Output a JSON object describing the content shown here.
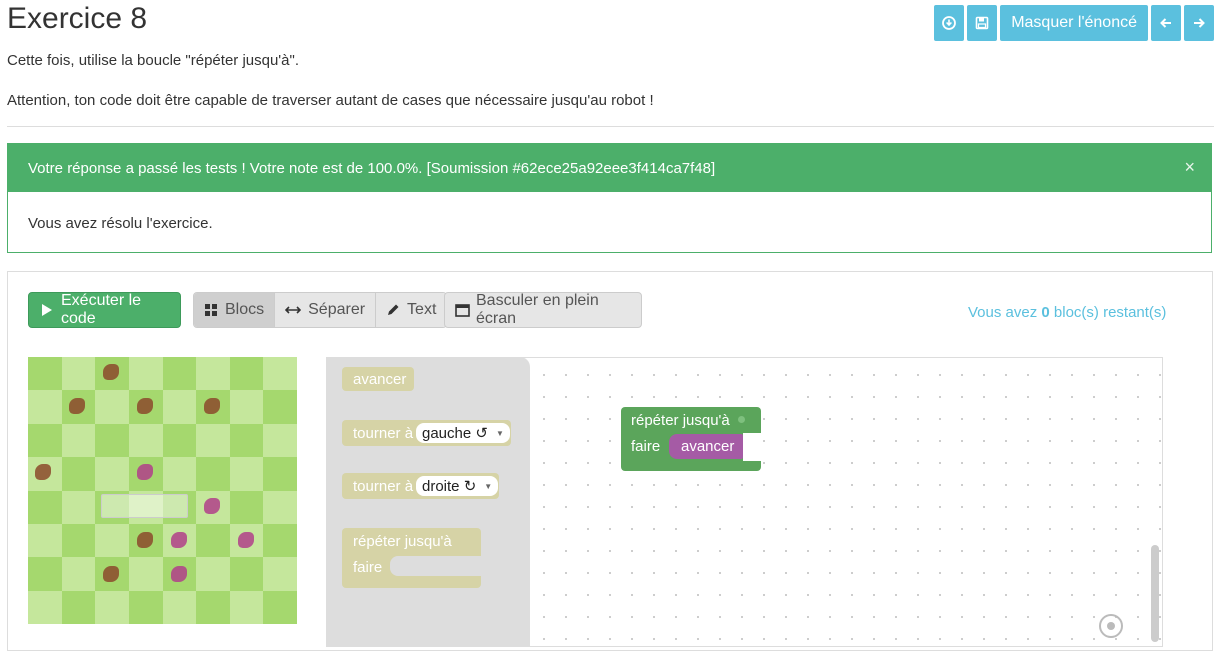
{
  "header": {
    "title": "Exercice 8",
    "buttons": {
      "download_icon": "download-icon",
      "save_icon": "save-icon",
      "hide_statement_label": "Masquer l'énoncé",
      "prev_icon": "arrow-left-icon",
      "next_icon": "arrow-right-icon"
    }
  },
  "statement": {
    "line1": "Cette fois, utilise la boucle \"répéter jusqu'à\".",
    "line2": "Attention, ton code doit être capable de traverser autant de cases que nécessaire jusqu'au robot !"
  },
  "alert": {
    "message": "Votre réponse a passé les tests ! Votre note est de 100.0%. [Soumission #62ece25a92eee3f414ca7f48]",
    "close": "×",
    "body": "Vous avez résolu l'exercice.",
    "color": "#4caf6a"
  },
  "toolbar": {
    "run_label": "Exécuter le code",
    "view_blocks": "Blocs",
    "view_split": "Séparer",
    "view_text": "Text",
    "fullscreen_label": "Basculer en plein écran",
    "remaining_prefix": "Vous avez ",
    "remaining_count": "0",
    "remaining_suffix": " bloc(s) restant(s)"
  },
  "toolbox": {
    "forward": "avancer",
    "turn_prefix": "tourner à",
    "turn_left_option": "gauche ↺",
    "turn_right_option": "droite ↻",
    "repeat_until": "répéter jusqu'à",
    "do_label": "faire"
  },
  "workspace": {
    "repeat_until": "répéter jusqu'à",
    "do_label": "faire",
    "inner_block": "avancer"
  },
  "colors": {
    "accent": "#5bc0de",
    "success": "#4caf6a",
    "loop_block": "#5ba55b",
    "action_block": "#a55ba5"
  }
}
